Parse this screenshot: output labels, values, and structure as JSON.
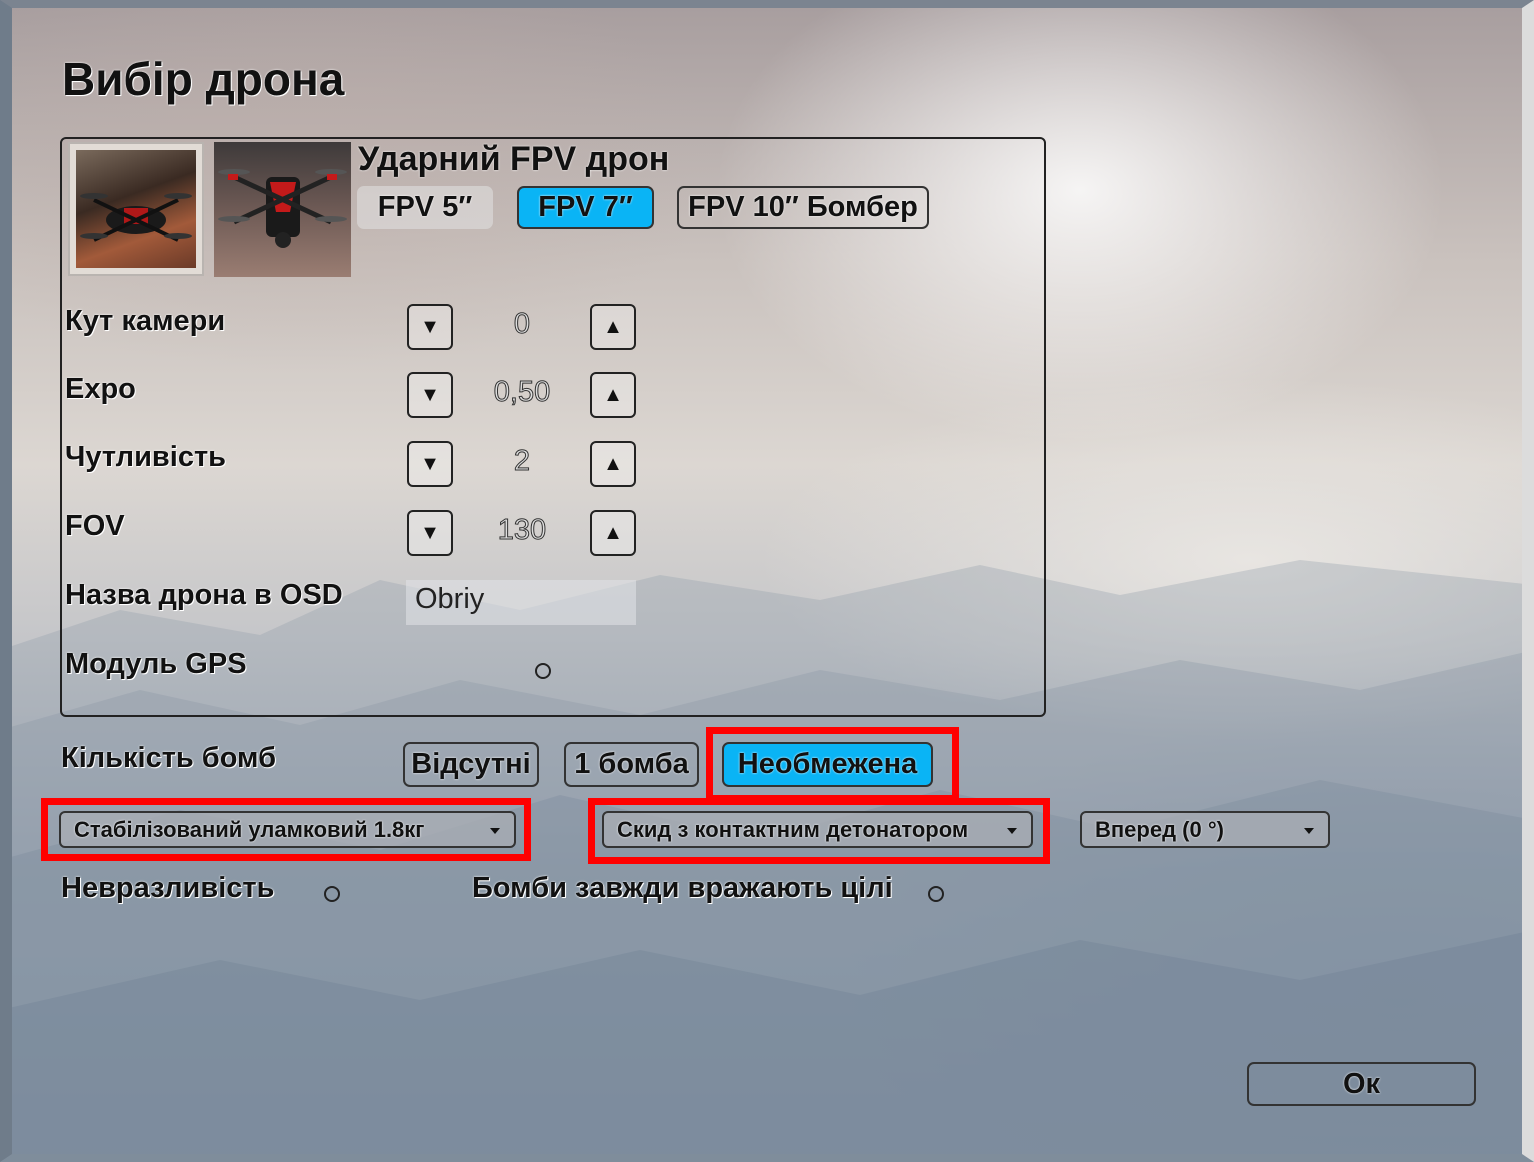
{
  "page": {
    "title": "Вибір дрона"
  },
  "drone": {
    "title": "Ударний FPV дрон",
    "variants": [
      {
        "label": "FPV 5″",
        "selected": false
      },
      {
        "label": "FPV 7″",
        "selected": true
      },
      {
        "label": "FPV 10″ Бомбер",
        "selected": false
      }
    ]
  },
  "settings": {
    "camera_angle": {
      "label": "Кут камери",
      "value": "0",
      "down_icon": "triangle-down-icon",
      "up_icon": "triangle-up-icon"
    },
    "expo": {
      "label": "Expo",
      "value": "0,50"
    },
    "sensitivity": {
      "label": "Чутливість",
      "value": "2"
    },
    "fov": {
      "label": "FOV",
      "value": "130"
    },
    "osd_name": {
      "label": "Назва дрона в OSD",
      "value": "Obriy"
    },
    "gps": {
      "label": "Модуль GPS",
      "checked": false
    }
  },
  "bombs": {
    "label": "Кількість бомб",
    "options": [
      {
        "label": "Відсутні",
        "selected": false
      },
      {
        "label": "1 бомба",
        "selected": false
      },
      {
        "label": "Необмежена",
        "selected": true
      }
    ],
    "bomb_type": "Стабілізований уламковий 1.8кг",
    "drop_mode": "Скид з контактним детонатором",
    "direction": "Вперед (0 °)"
  },
  "toggles": {
    "invulnerability": {
      "label": "Невразливість",
      "checked": false
    },
    "always_hit": {
      "label": "Бомби завжди вражають цілі",
      "checked": false
    }
  },
  "actions": {
    "ok": "Ок"
  },
  "colors": {
    "accent": "#0ab4f5",
    "highlight": "#ff0000"
  }
}
